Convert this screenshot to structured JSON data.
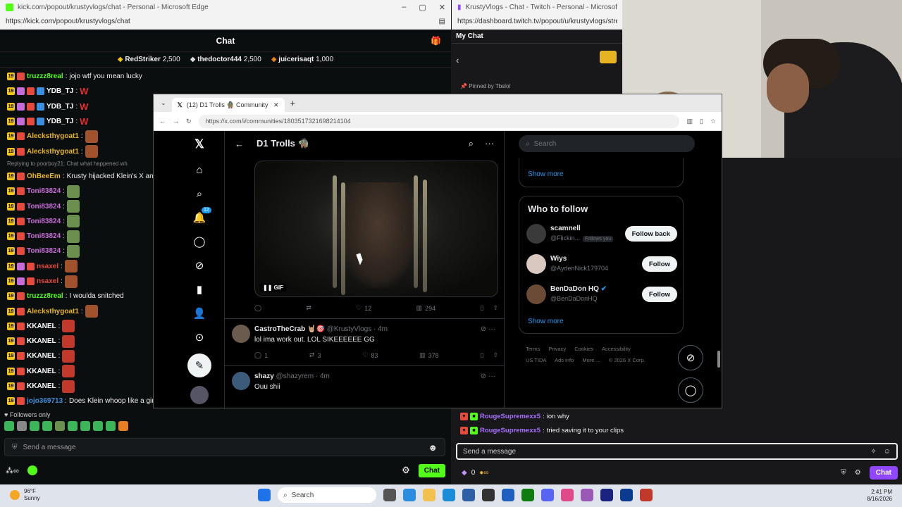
{
  "kick": {
    "title": "kick.com/popout/krustyvlogs/chat - Personal - Microsoft Edge",
    "url": "https://kick.com/popout/krustyvlogs/chat",
    "header": "Chat",
    "leaders": [
      {
        "name": "RedStriker",
        "amount": "2,500",
        "color": "#f5c518"
      },
      {
        "name": "thedoctor444",
        "amount": "2,500",
        "color": "#ffffff"
      },
      {
        "name": "juicerisaqt",
        "amount": "1,000",
        "color": "#e67e22"
      }
    ],
    "messages": [
      {
        "user": "truzzz8real",
        "color": "#53fc18",
        "text": "jojo wtf you mean lucky"
      },
      {
        "user": "YDB_TJ",
        "color": "#ffffff",
        "text": "W"
      },
      {
        "user": "YDB_TJ",
        "color": "#ffffff",
        "text": "W"
      },
      {
        "user": "YDB_TJ",
        "color": "#ffffff",
        "text": "W"
      },
      {
        "user": "Alecksthygoat1",
        "color": "#e6b422",
        "text": ""
      },
      {
        "user": "Alecksthygoat1",
        "color": "#e6b422",
        "text": ""
      },
      {
        "reply": "Replying to poorboy21: Chat what happened wh"
      },
      {
        "user": "OhBeeEm",
        "color": "#e6b422",
        "text": "Krusty hijacked Klein's X and p"
      },
      {
        "user": "Toni83824",
        "color": "#c86ad8",
        "text": ""
      },
      {
        "user": "Toni83824",
        "color": "#c86ad8",
        "text": ""
      },
      {
        "user": "Toni83824",
        "color": "#c86ad8",
        "text": ""
      },
      {
        "user": "Toni83824",
        "color": "#c86ad8",
        "text": ""
      },
      {
        "user": "Toni83824",
        "color": "#c86ad8",
        "text": ""
      },
      {
        "user": "nsaxel",
        "color": "#e64a3c",
        "text": ""
      },
      {
        "user": "nsaxel",
        "color": "#e64a3c",
        "text": ""
      },
      {
        "user": "truzzz8real",
        "color": "#53fc18",
        "text": "I woulda snitched"
      },
      {
        "user": "Alecksthygoat1",
        "color": "#e6b422",
        "text": ""
      },
      {
        "user": "KKANEL",
        "color": "#ffffff",
        "text": ""
      },
      {
        "user": "KKANEL",
        "color": "#ffffff",
        "text": ""
      },
      {
        "user": "KKANEL",
        "color": "#ffffff",
        "text": ""
      },
      {
        "user": "KKANEL",
        "color": "#ffffff",
        "text": ""
      },
      {
        "user": "KKANEL",
        "color": "#ffffff",
        "text": ""
      },
      {
        "user": "jojo369713",
        "color": "#3a8fe0",
        "text": "Does Klein whoop like a girl?"
      }
    ],
    "followers_only": "Followers only",
    "input_placeholder": "Send a message",
    "chat_button": "Chat"
  },
  "twitch": {
    "title": "KrustyVlogs - Chat - Twitch - Personal - Microsoft Edge",
    "url": "https://dashboard.twitch.tv/popout/u/krustyvlogs/stre",
    "header": "My Chat",
    "pinned": "Pinned by Tbslol",
    "messages": [
      {
        "user": "RougeSupremexx5",
        "text": "ion why"
      },
      {
        "user": "RougeSupremexx5",
        "text": "tried saving it to your clips"
      }
    ],
    "input_placeholder": "Send a message",
    "points": "0",
    "chat_button": "Chat"
  },
  "x": {
    "tab_title": "(12) D1 Trolls 🧌 Community / X",
    "url": "https://x.com/i/communities/1803517321698214104",
    "community": "D1 Trolls 🧌",
    "notification_count": "12",
    "gif_label": "GIF",
    "gif_actions": {
      "likes": "12",
      "views": "294"
    },
    "tweets": [
      {
        "name": "CastroTheCrab 🤘🏼🎯",
        "handle": "@KrustyVlogs · 4m",
        "text": "lol ima work out. LOL SIKEEEEEE GG",
        "replies": "1",
        "retweets": "3",
        "likes": "83",
        "views": "378"
      },
      {
        "name": "shazy",
        "handle": "@shazyrem · 4m",
        "text": "Ouu shii"
      }
    ],
    "search_placeholder": "Search",
    "show_more": "Show more",
    "who_to_follow": "Who to follow",
    "follow_suggestions": [
      {
        "name": "scamnell",
        "handle": "@Flickin...",
        "follows_you": "Follows you",
        "button": "Follow back"
      },
      {
        "name": "Wiys",
        "handle": "@AydenNick179704",
        "button": "Follow"
      },
      {
        "name": "BenDaDon HQ",
        "handle": "@BenDaDonHQ",
        "button": "Follow"
      }
    ],
    "footer": [
      "Terms",
      "Privacy",
      "Cookies",
      "Accessibility",
      "US TIDA",
      "Ads info",
      "More ...",
      "© 2026 X Corp."
    ]
  },
  "taskbar": {
    "temp": "96°F",
    "condition": "Sunny",
    "search": "Search",
    "time": "2:41 PM",
    "date": "8/16/2026"
  }
}
